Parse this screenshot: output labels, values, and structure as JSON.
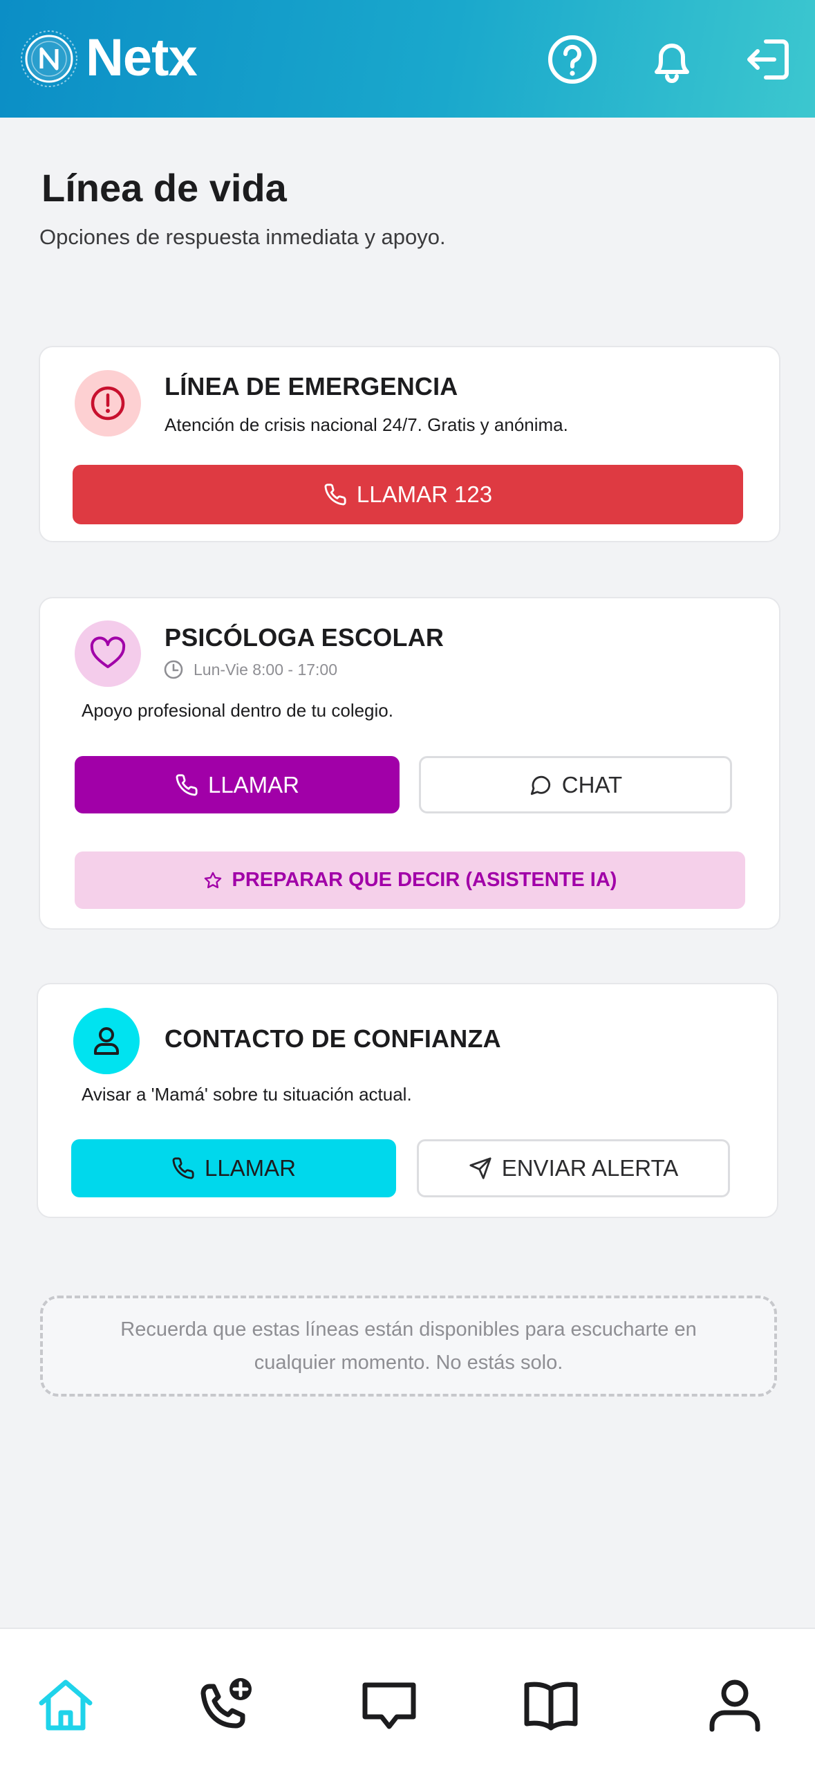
{
  "app": {
    "name": "Netx"
  },
  "header": {
    "help_icon": "help-circle-icon",
    "notifications_icon": "bell-icon",
    "logout_icon": "logout-icon"
  },
  "page": {
    "title": "Línea de vida",
    "subtitle": "Opciones de respuesta inmediata y apoyo."
  },
  "emergency": {
    "title": "LÍNEA DE EMERGENCIA",
    "description": "Atención de crisis nacional 24/7. Gratis y anónima.",
    "call_label": "LLAMAR 123",
    "icon": "alert-circle-icon",
    "accent": "#de3a42"
  },
  "psychologist": {
    "title": "PSICÓLOGA ESCOLAR",
    "hours": "Lun-Vie 8:00 - 17:00",
    "description": "Apoyo profesional dentro de tu colegio.",
    "call_label": "LLAMAR",
    "chat_label": "CHAT",
    "assistant_label": "PREPARAR QUE DECIR (ASISTENTE IA)",
    "icon": "heart-icon",
    "accent": "#a100a8"
  },
  "trusted_contact": {
    "title": "CONTACTO DE CONFIANZA",
    "description": "Avisar a 'Mamá' sobre tu situación actual.",
    "call_label": "LLAMAR",
    "alert_label": "ENVIAR ALERTA",
    "icon": "user-icon",
    "accent": "#00d8ec"
  },
  "note": {
    "text": "Recuerda que estas líneas están disponibles para escucharte en cualquier momento. No estás solo."
  },
  "bottom_nav": {
    "items": [
      "home-icon",
      "phone-plus-icon",
      "chat-icon",
      "book-icon",
      "profile-icon"
    ],
    "active": "home-icon"
  }
}
